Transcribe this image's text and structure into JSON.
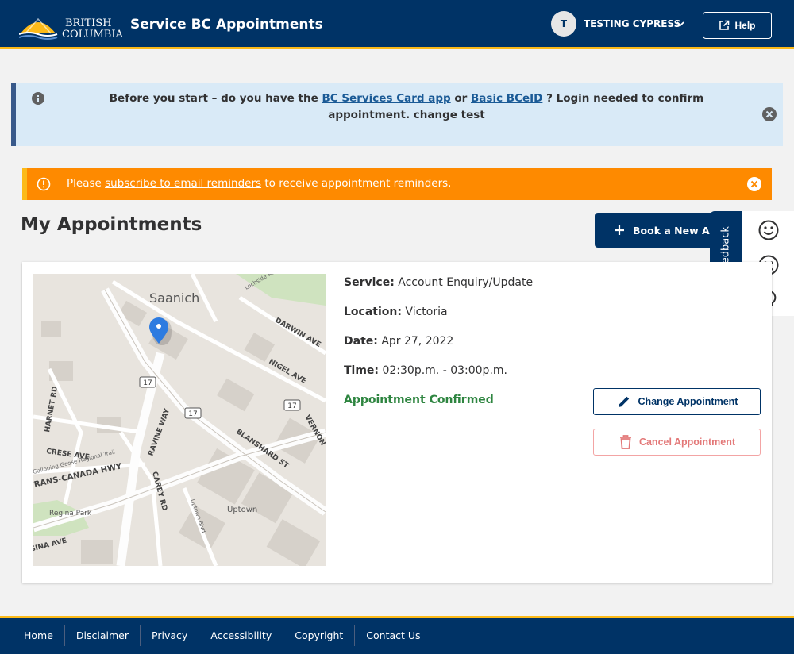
{
  "header": {
    "logo_line1": "BRITISH",
    "logo_line2": "COLUMBIA",
    "title": "Service BC Appointments",
    "user_initial": "T",
    "user_name": "TESTING CYPRESS",
    "help_label": "Help",
    "colors": {
      "background": "#003366",
      "accent": "#fcba19"
    }
  },
  "info_banner": {
    "text_before": "Before you start – do you have the",
    "link1": "BC Services Card app",
    "text_mid": "or",
    "link2": "Basic BCeID",
    "text_after": "? Login needed to confirm appointment. change test"
  },
  "warning_banner": {
    "text_before": "Please",
    "link": "subscribe to email reminders",
    "text_after": "to receive appointment reminders.",
    "color": "#fe8a00"
  },
  "page": {
    "title": "My Appointments",
    "book_button": "Book a New Appointment"
  },
  "feedback": {
    "tab_label": "Your Feedback",
    "icons": [
      "smile-icon",
      "frown-icon",
      "lightbulb-icon"
    ]
  },
  "appointment": {
    "map": {
      "places": [
        "Saanich",
        "Uptown",
        "Regina Park"
      ],
      "streets": [
        "DARWIN AVE",
        "NIGEL AVE",
        "BLANSHARD ST",
        "RAVINE WAY",
        "CAREY RD",
        "CRESE AVE",
        "HARNET RD",
        "VERNON",
        "TRANS-CANADA HWY",
        "GINA AVE",
        "Lochside Regional",
        "Uptown Blvd",
        "Galloping Goose Regional Trail"
      ],
      "route_shields": [
        "17",
        "17",
        "17"
      ]
    },
    "service_label": "Service:",
    "service": "Account Enquiry/Update",
    "location_label": "Location:",
    "location": "Victoria",
    "date_label": "Date:",
    "date": "Apr 27, 2022",
    "time_label": "Time:",
    "time": "02:30p.m. - 03:00p.m.",
    "status": "Appointment Confirmed",
    "change_button": "Change Appointment",
    "cancel_button": "Cancel Appointment"
  },
  "footer": {
    "links": [
      "Home",
      "Disclaimer",
      "Privacy",
      "Accessibility",
      "Copyright",
      "Contact Us"
    ]
  }
}
